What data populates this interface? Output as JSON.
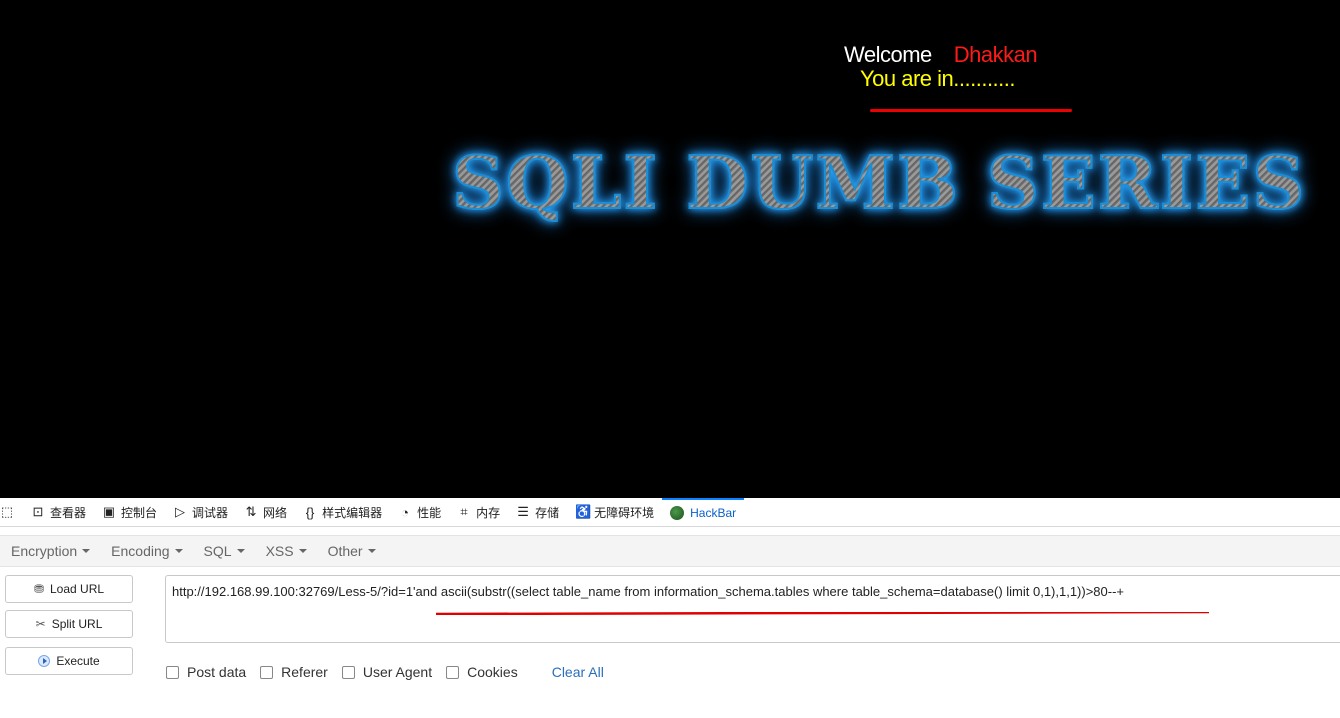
{
  "page": {
    "welcome_label": "Welcome",
    "user_name": "Dhakkan",
    "status_text": "You are in...........",
    "banner_text": "SQLI DUMB SERIES"
  },
  "devtools": {
    "tabs": [
      {
        "label": "查看器",
        "icon": "inspector-icon"
      },
      {
        "label": "控制台",
        "icon": "console-icon"
      },
      {
        "label": "调试器",
        "icon": "debugger-icon"
      },
      {
        "label": "网络",
        "icon": "network-icon"
      },
      {
        "label": "样式编辑器",
        "icon": "style-editor-icon"
      },
      {
        "label": "性能",
        "icon": "performance-icon"
      },
      {
        "label": "内存",
        "icon": "memory-icon"
      },
      {
        "label": "存储",
        "icon": "storage-icon"
      },
      {
        "label": "无障碍环境",
        "icon": "accessibility-icon"
      },
      {
        "label": "HackBar",
        "icon": "hackbar-icon"
      }
    ]
  },
  "hackbar": {
    "menus": [
      "Encryption",
      "Encoding",
      "SQL",
      "XSS",
      "Other"
    ],
    "buttons": {
      "load": "Load URL",
      "split": "Split URL",
      "execute": "Execute"
    },
    "url": "http://192.168.99.100:32769/Less-5/?id=1'and ascii(substr((select table_name from information_schema.tables where table_schema=database() limit 0,1),1,1))>80--+",
    "options": [
      "Post data",
      "Referer",
      "User Agent",
      "Cookies"
    ],
    "clear_all": "Clear All"
  },
  "colors": {
    "accent_tab": "#0a84ff",
    "annotation_red": "#e00000",
    "welcome_name": "#ff1a1a",
    "status_yellow": "#ffff00"
  }
}
